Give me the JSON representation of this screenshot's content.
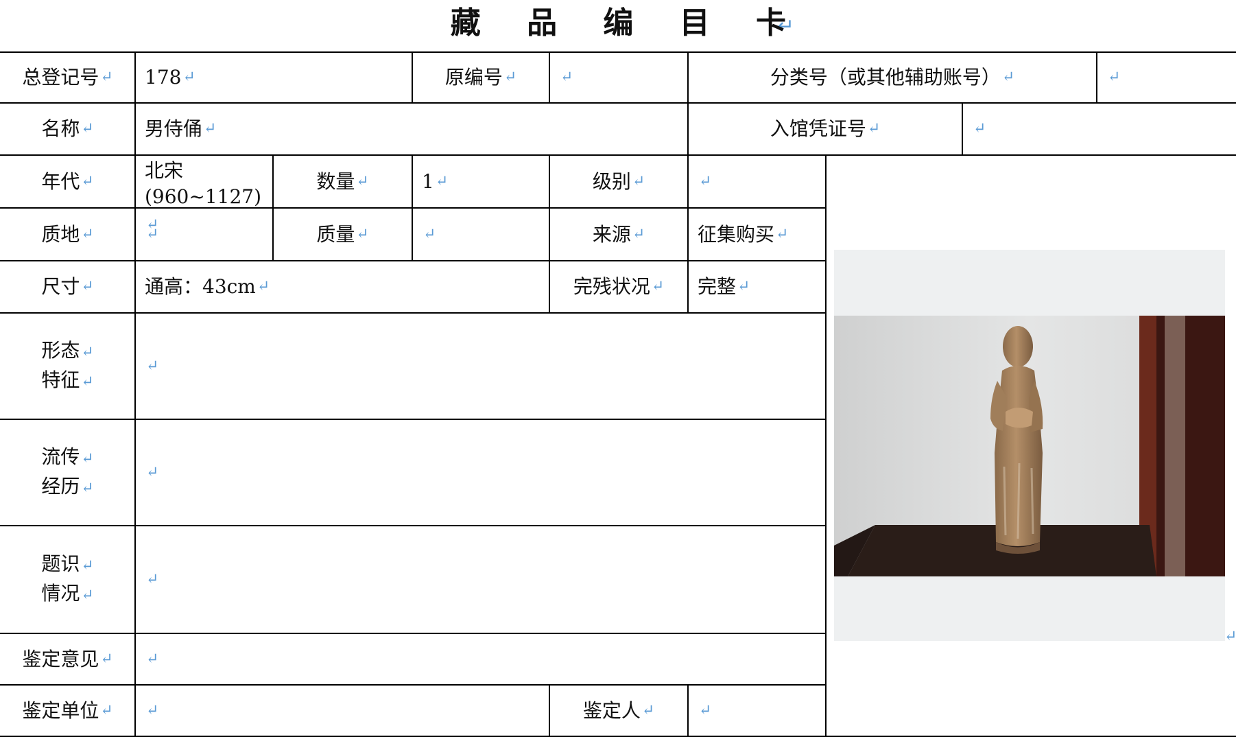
{
  "card": {
    "title": "藏 品 编 目 卡",
    "return_mark": "↵",
    "labels": {
      "registration_no": "总登记号",
      "original_no": "原编号",
      "classification_no": "分类号（或其他辅助账号）",
      "name": "名称",
      "entry_voucher_no": "入馆凭证号",
      "era": "年代",
      "quantity": "数量",
      "grade": "级别",
      "material": "质地",
      "weight": "质量",
      "source": "来源",
      "dimensions": "尺寸",
      "condition": "完残状况",
      "form_line1": "形态",
      "form_line2": "特征",
      "provenance_line1": "流传",
      "provenance_line2": "经历",
      "inscription_line1": "题识",
      "inscription_line2": "情况",
      "appraisal_opinion": "鉴定意见",
      "appraisal_unit": "鉴定单位",
      "appraiser": "鉴定人"
    },
    "values": {
      "registration_no": "178",
      "original_no": "",
      "classification_no": "",
      "name": "男侍俑",
      "entry_voucher_no": "",
      "era_line1": "北宋",
      "era_line2": "(960~1127)",
      "quantity": "1",
      "grade": "",
      "material": "",
      "weight": "",
      "source": "征集购买",
      "dimensions": "通高：43cm",
      "condition": "完整",
      "form": "",
      "provenance": "",
      "inscription": "",
      "appraisal_opinion": "",
      "appraisal_unit": "",
      "appraiser": ""
    }
  },
  "colors": {
    "border": "#000000",
    "paragraph_mark": "#5b9bd5",
    "photo_background": "#eef0f1"
  }
}
